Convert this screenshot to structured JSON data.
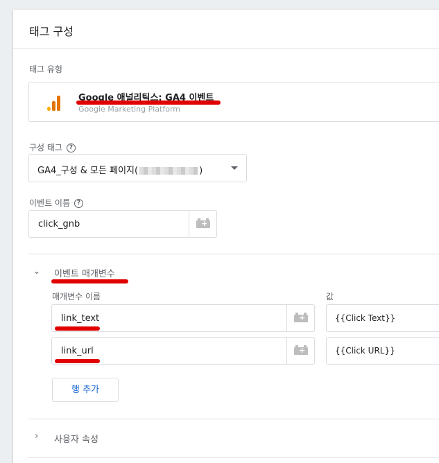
{
  "panel": {
    "title": "태그 구성"
  },
  "tag_type": {
    "label": "태그 유형",
    "name": "Google 애널리틱스: GA4 이벤트",
    "platform": "Google Marketing Platform",
    "icon": "analytics-bars-icon",
    "icon_colors": [
      "#f9ab00",
      "#e37400",
      "#e37400"
    ]
  },
  "config_tag": {
    "label": "구성 태그",
    "value_prefix": "GA4_구성 & 모든 페이지(",
    "value_suffix": ")"
  },
  "event_name": {
    "label": "이벤트 이름",
    "value": "click_gnb"
  },
  "event_params": {
    "title": "이벤트 매개변수",
    "col_name": "매개변수 이름",
    "col_value": "값",
    "rows": [
      {
        "name": "link_text",
        "value": "{{Click Text}}"
      },
      {
        "name": "link_url",
        "value": "{{Click URL}}"
      }
    ],
    "add_row": "행 추가"
  },
  "user_props": {
    "title": "사용자 속성"
  },
  "colors": {
    "accent": "#1967d2",
    "highlight": "#e00000"
  }
}
